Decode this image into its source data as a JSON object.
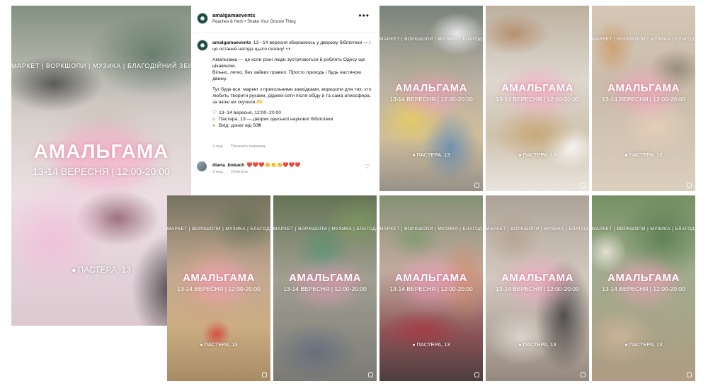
{
  "story": {
    "categories": "МАРКЕТ | ВОРКШОПИ | МУЗИКА | БЛАГОДІЙНИЙ ЗБІР",
    "title": "АМАЛЬГАМА",
    "date": "13-14 ВЕРЕСНЯ | 12:00-20:00",
    "location": "ПАСТЕРА, 13",
    "pin_icon": "location-pin-icon"
  },
  "post": {
    "username": "amalgamaevents",
    "audio": "Peaches & Herb • Shake Your Groove Thing",
    "caption_intro": "13 –14 вересня збираємось у дворику бібліотеки — і це остання нагода цього сезону! 👀",
    "caption_p2": "Амальгама — це коли різні люди зустрічаються й роблять Одесу ще цікавішою.",
    "caption_p3": "Вільно, легко, без зайвих правил. Просто приходь і будь частиною движу.",
    "caption_p4": "Тут буде все: маркет з прикольними знахідками, воркшопи для тих, хто любить творити руками, діджей-сети після обіду й та сама атмосфера, за якою ви скучили.🫶",
    "detail_date": "13–14 вересня, 12:00–20:00",
    "detail_place": "Пастера, 13 — дворик одеської наукової бібліотеки",
    "detail_entry": "Вхід: донат від 50₴",
    "caption_time": "4 нед.",
    "see_translation": "Показать перевод",
    "comment_user": "diana_bokach",
    "comment_text": "❤️❤️❤️👏👏👏❤️❤️❤️",
    "comment_time": "3 нед.",
    "reply_label": "Ответить"
  },
  "colors": {
    "accent_pink": "#ff8fb8",
    "text_muted": "#8e8e8e",
    "avatar_green": "#1f4a44"
  }
}
